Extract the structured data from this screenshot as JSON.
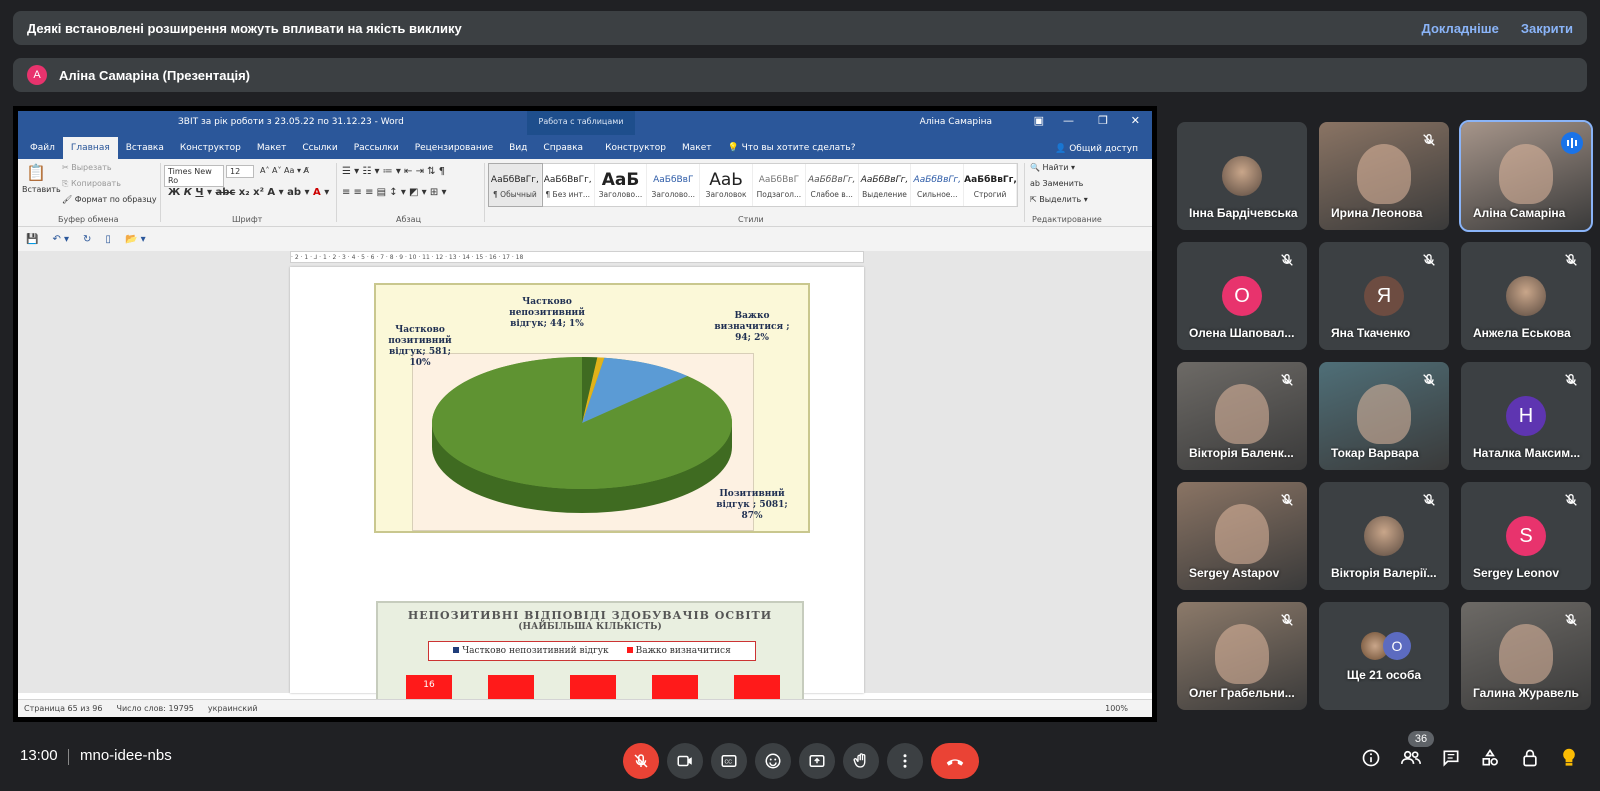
{
  "banner": {
    "text": "Деякі встановлені розширення можуть впливати на якість виклику",
    "more_link": "Докладніше",
    "close_link": "Закрити"
  },
  "presenter": {
    "initial": "A",
    "label": "Аліна Самаріна (Презентація)"
  },
  "word": {
    "title": "ЗВІТ за рік роботи з 23.05.22 по 31.12.23  -  Word",
    "context_tab": "Работа с таблицами",
    "user": "Аліна Самаріна",
    "tabs": [
      "Файл",
      "Главная",
      "Вставка",
      "Конструктор",
      "Макет",
      "Ссылки",
      "Рассылки",
      "Рецензирование",
      "Вид",
      "Справка",
      "Конструктор",
      "Макет"
    ],
    "active_tab": "Главная",
    "tell_me": "Что вы хотите сделать?",
    "share": "Общий доступ",
    "clipboard": {
      "paste": "Вставить",
      "cut": "Вырезать",
      "copy": "Копировать",
      "format_painter": "Формат по образцу",
      "label": "Буфер обмена"
    },
    "font": {
      "name": "Times New Ro",
      "size": "12",
      "label": "Шрифт"
    },
    "paragraph_label": "Абзац",
    "styles": [
      {
        "sample": "АаБбВвГг,",
        "name": "¶ Обычный"
      },
      {
        "sample": "АаБбВвГг,",
        "name": "¶ Без инт..."
      },
      {
        "sample": "АаБ",
        "name": "Заголово..."
      },
      {
        "sample": "АаБбВвГ",
        "name": "Заголово..."
      },
      {
        "sample": "АаЬ",
        "name": "Заголовок"
      },
      {
        "sample": "АаБбВвГ",
        "name": "Подзагол..."
      },
      {
        "sample": "АаБбВвГг,",
        "name": "Слабое в..."
      },
      {
        "sample": "АаБбВвГг,",
        "name": "Выделение"
      },
      {
        "sample": "АаБбВвГг,",
        "name": "Сильное..."
      },
      {
        "sample": "АаБбВвГг,",
        "name": "Строгий"
      }
    ],
    "styles_label": "Стили",
    "editing": {
      "find": "Найти",
      "replace": "Заменить",
      "select": "Выделить",
      "label": "Редактирование"
    },
    "ruler_text": "· 2 · 1 · ⅃ · 1 · 2 · 3 · 4 · 5 · 6 · 7 · 8 · 9 · 10 · 11 · 12 · 13 · 14 · 15 · 16 · 17 · 18",
    "status": {
      "page": "Страница 65 из 96",
      "words": "Число слов: 19795",
      "lang": "украинский",
      "zoom": "100%"
    }
  },
  "chart_data": [
    {
      "type": "pie",
      "categories": [
        "Позитивний відгук",
        "Частково позитивний відгук",
        "Частково непозитивний відгук",
        "Важко визначитися"
      ],
      "values": [
        5081,
        581,
        44,
        94
      ],
      "percents": [
        87,
        10,
        1,
        2
      ],
      "labels": [
        "Позитивний відгук ; 5081; 87%",
        "Частково позитивний відгук; 581; 10%",
        "Частково непозитивний відгук; 44; 1%",
        "Важко визначитися ; 94; 2%"
      ],
      "colors": [
        "#5f9332",
        "#5b9bd5",
        "#e2b21a",
        "#3f6b21"
      ]
    },
    {
      "type": "bar",
      "title": "НЕПОЗИТИВНІ ВІДПОВІДІ ЗДОБУВАЧІВ ОСВІТИ",
      "subtitle": "(НАЙБІЛЬША КІЛЬКІСТЬ)",
      "series": [
        {
          "name": "Частково непозитивний відгук"
        },
        {
          "name": "Важко визначитися"
        }
      ],
      "visible_values": [
        "16"
      ],
      "colors": [
        "#1f3d7a",
        "#ff1a1a"
      ]
    }
  ],
  "participants": [
    {
      "name": "Інна Бардічевська",
      "type": "photo",
      "muted": false
    },
    {
      "name": "Ирина Леонова",
      "type": "video",
      "muted": true
    },
    {
      "name": "Аліна Самаріна",
      "type": "video",
      "muted": false,
      "speaking": true
    },
    {
      "name": "Олена Шаповал...",
      "type": "avatar",
      "initial": "О",
      "color": "#e8336d",
      "muted": true
    },
    {
      "name": "Яна Ткаченко",
      "type": "avatar",
      "initial": "Я",
      "color": "#6d4c41",
      "muted": true
    },
    {
      "name": "Анжела Еськова",
      "type": "photo",
      "muted": true
    },
    {
      "name": "Вікторія Баленк...",
      "type": "video",
      "muted": true
    },
    {
      "name": "Токар Варвара",
      "type": "video",
      "muted": true
    },
    {
      "name": "Наталка Максим...",
      "type": "avatar",
      "initial": "Н",
      "color": "#5e35b1",
      "muted": true
    },
    {
      "name": "Sergey Astapov",
      "type": "video",
      "muted": true
    },
    {
      "name": "Вікторія Валерії...",
      "type": "photo",
      "muted": true
    },
    {
      "name": "Sergey Leonov",
      "type": "avatar",
      "initial": "S",
      "color": "#e8336d",
      "muted": true
    },
    {
      "name": "Олег Грабельни...",
      "type": "video",
      "muted": true
    },
    {
      "name": "Ще 21 особа",
      "type": "more",
      "initial": "O",
      "muted": false
    },
    {
      "name": "Галина Журавель",
      "type": "video",
      "muted": true
    }
  ],
  "bottom": {
    "time": "13:00",
    "meeting_code": "mno-idee-nbs",
    "people_count": "36"
  }
}
